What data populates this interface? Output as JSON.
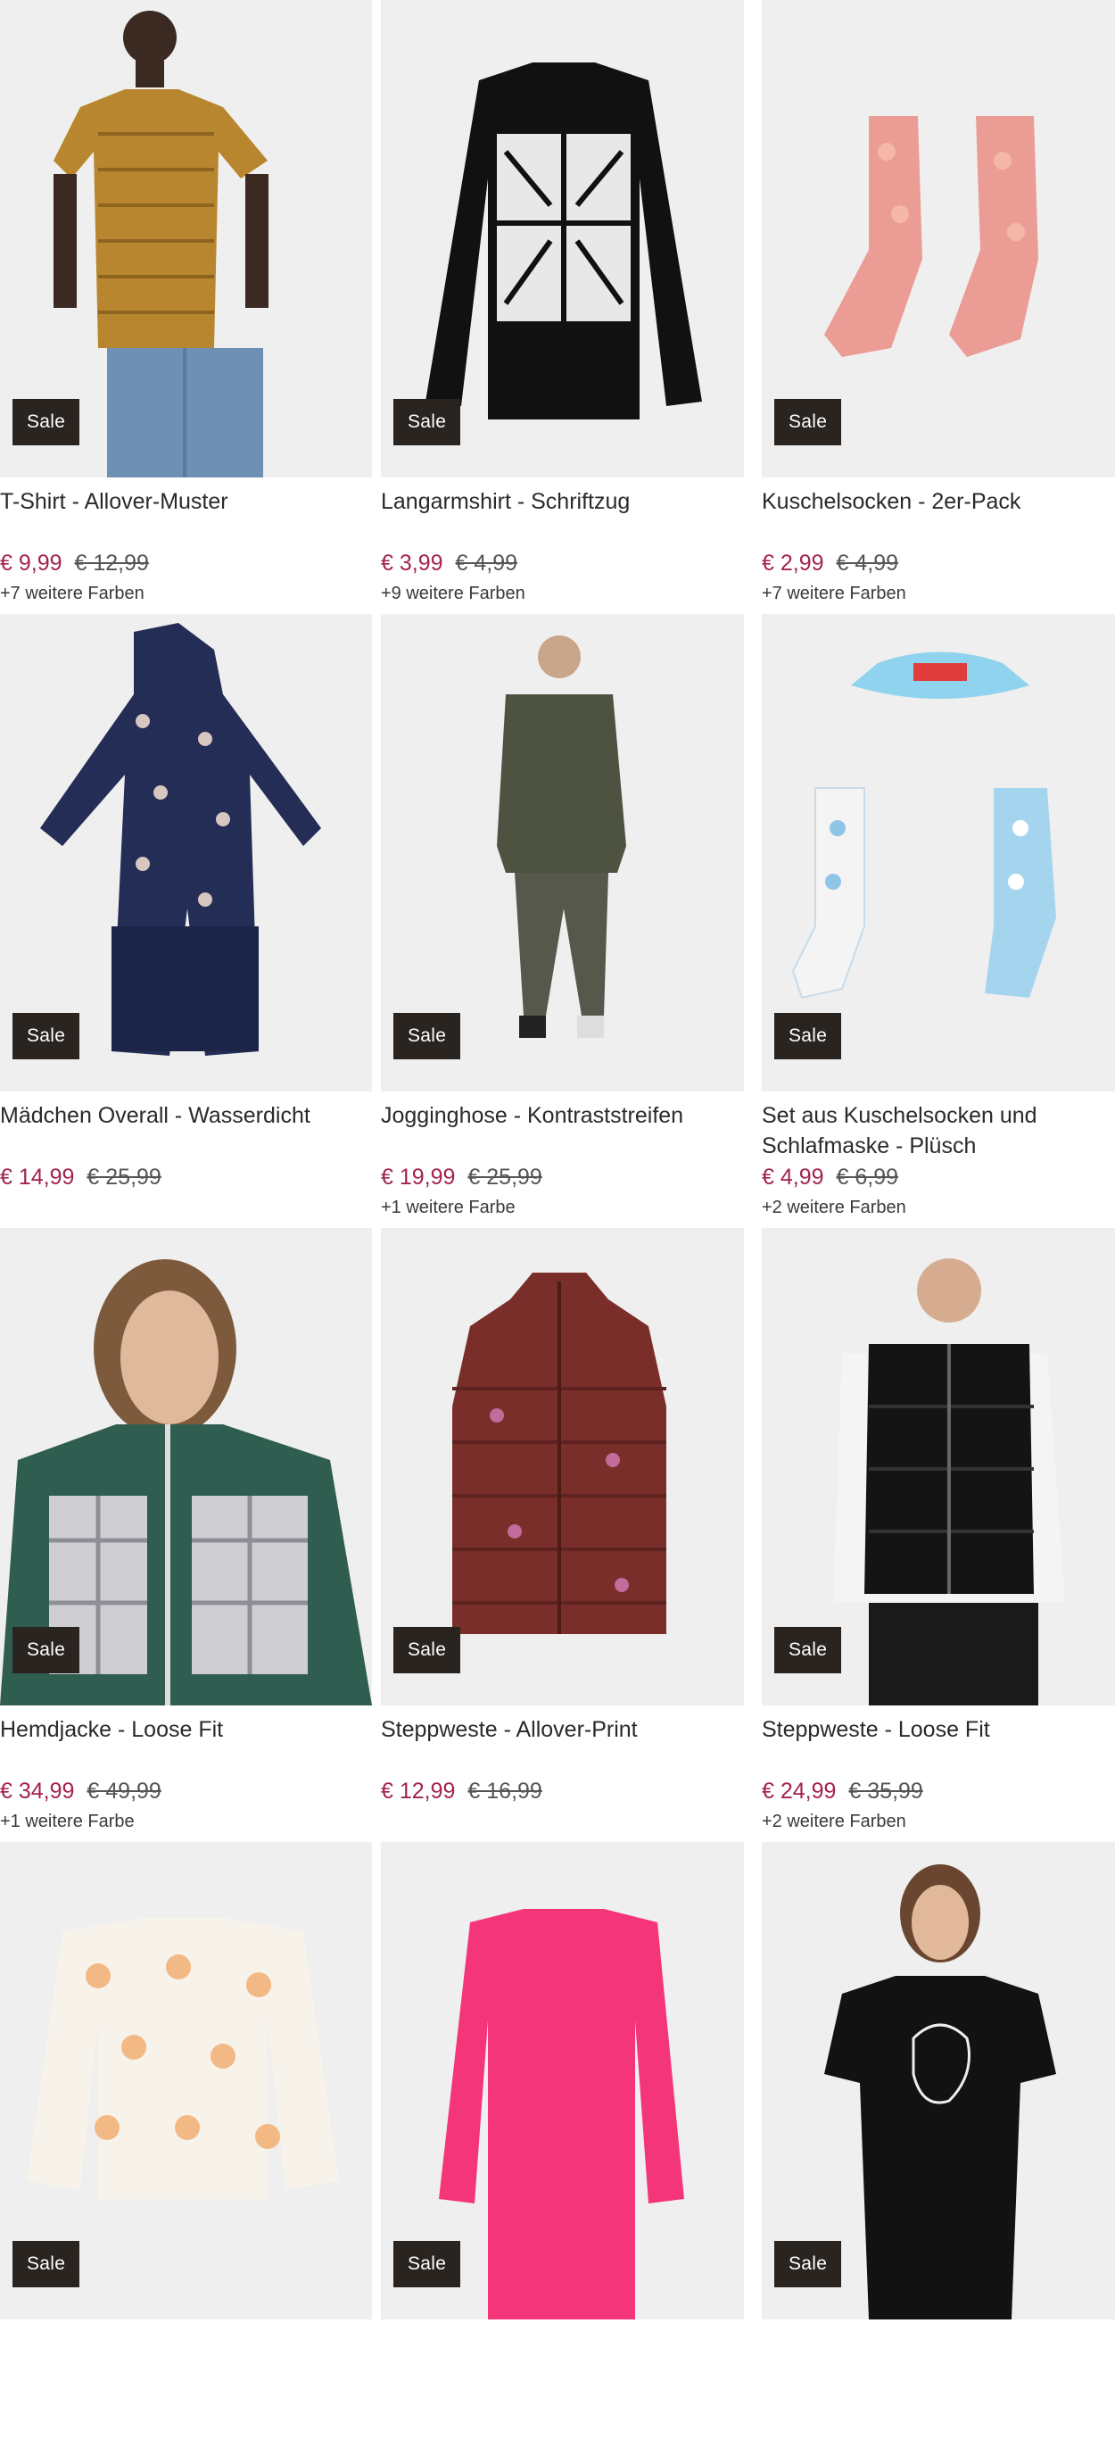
{
  "products": [
    {
      "title": "T-Shirt - Allover-Muster",
      "price": "€ 9,99",
      "old_price": "€ 12,99",
      "colors": "+7 weitere Farben",
      "badge": "Sale",
      "image": "tshirt-pattern"
    },
    {
      "title": "Langarmshirt - Schriftzug",
      "price": "€ 3,99",
      "old_price": "€ 4,99",
      "colors": "+9 weitere Farben",
      "badge": "Sale",
      "image": "longsleeve-black"
    },
    {
      "title": "Kuschelsocken - 2er-Pack",
      "price": "€ 2,99",
      "old_price": "€ 4,99",
      "colors": "+7 weitere Farben",
      "badge": "Sale",
      "image": "socks-pink"
    },
    {
      "title": "Mädchen Overall - Wasserdicht",
      "price": "€ 14,99",
      "old_price": "€ 25,99",
      "colors": "",
      "badge": "Sale",
      "image": "overall-navy"
    },
    {
      "title": "Jogginghose - Kontraststreifen",
      "price": "€ 19,99",
      "old_price": "€ 25,99",
      "colors": "+1 weitere Farbe",
      "badge": "Sale",
      "image": "jogger-olive"
    },
    {
      "title": "Set aus Kuschelsocken und Schlafmaske - Plüsch",
      "price": "€ 4,99",
      "old_price": "€ 6,99",
      "colors": "+2 weitere Farben",
      "badge": "Sale",
      "image": "socks-mask-set"
    },
    {
      "title": "Hemdjacke - Loose Fit",
      "price": "€ 34,99",
      "old_price": "€ 49,99",
      "colors": "+1 weitere Farbe",
      "badge": "Sale",
      "image": "shirt-jacket-plaid"
    },
    {
      "title": "Steppweste - Allover-Print",
      "price": "€ 12,99",
      "old_price": "€ 16,99",
      "colors": "",
      "badge": "Sale",
      "image": "vest-burgundy"
    },
    {
      "title": "Steppweste - Loose Fit",
      "price": "€ 24,99",
      "old_price": "€ 35,99",
      "colors": "+2 weitere Farben",
      "badge": "Sale",
      "image": "vest-black"
    },
    {
      "title": "",
      "price": "",
      "old_price": "",
      "colors": "",
      "badge": "Sale",
      "image": "kids-longsleeve-flowers"
    },
    {
      "title": "",
      "price": "",
      "old_price": "",
      "colors": "",
      "badge": "Sale",
      "image": "longsleeve-pink"
    },
    {
      "title": "",
      "price": "",
      "old_price": "",
      "colors": "",
      "badge": "Sale",
      "image": "tshirt-face-print"
    }
  ],
  "colors": {
    "sale_price": "#a3234d",
    "badge_bg": "#2a2421",
    "tile_bg": "#f1f1f1"
  }
}
